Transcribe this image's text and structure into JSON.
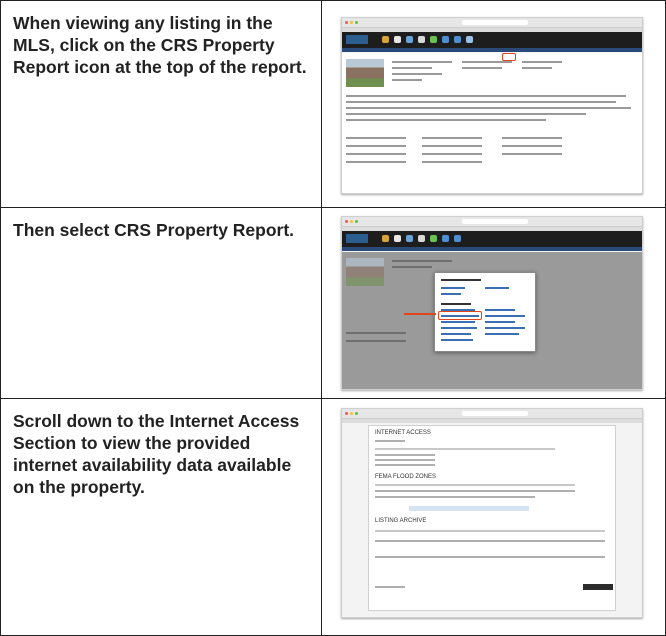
{
  "steps": [
    {
      "text": "When viewing any listing in the MLS, click on the CRS Property Report icon at the top of the report.",
      "image": "mls-listing-screenshot"
    },
    {
      "text": "Then select CRS Property Report.",
      "image": "crs-menu-screenshot"
    },
    {
      "text": "Scroll down to the Internet Access Section to view the provided internet availability data available on the property.",
      "image": "internet-access-screenshot"
    }
  ],
  "screenshot3": {
    "internet_title": "INTERNET ACCESS",
    "flood_title": "FEMA FLOOD ZONES",
    "archive_title": "LISTING ARCHIVE"
  }
}
